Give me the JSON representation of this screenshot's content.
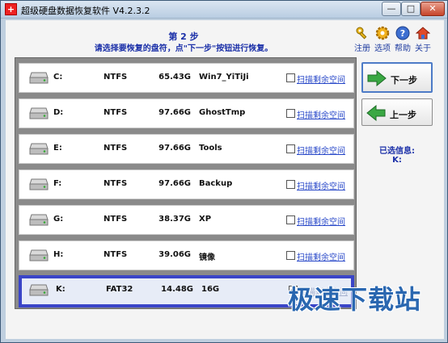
{
  "window": {
    "title": "超级硬盘数据恢复软件 V4.2.3.2",
    "min_label": "—",
    "max_label": "□",
    "close_label": "✕"
  },
  "header": {
    "step_title": "第 2 步",
    "step_desc": "请选择要恢复的盘符，点\"下一步\"按钮进行恢复。"
  },
  "toolbar": {
    "items": [
      {
        "label": "注册",
        "icon": "key-icon"
      },
      {
        "label": "选项",
        "icon": "gear-icon"
      },
      {
        "label": "帮助",
        "icon": "help-icon"
      },
      {
        "label": "关于",
        "icon": "house-icon"
      }
    ]
  },
  "disks": [
    {
      "letter": "C:",
      "fs": "NTFS",
      "size": "65.43G",
      "label": "Win7_YiTiJi",
      "checked": false,
      "scan": "扫描剩余空间"
    },
    {
      "letter": "D:",
      "fs": "NTFS",
      "size": "97.66G",
      "label": "GhostTmp",
      "checked": false,
      "scan": "扫描剩余空间"
    },
    {
      "letter": "E:",
      "fs": "NTFS",
      "size": "97.66G",
      "label": "Tools",
      "checked": false,
      "scan": "扫描剩余空间"
    },
    {
      "letter": "F:",
      "fs": "NTFS",
      "size": "97.66G",
      "label": "Backup",
      "checked": false,
      "scan": "扫描剩余空间"
    },
    {
      "letter": "G:",
      "fs": "NTFS",
      "size": "38.37G",
      "label": "XP",
      "checked": false,
      "scan": "扫描剩余空间"
    },
    {
      "letter": "H:",
      "fs": "NTFS",
      "size": "39.06G",
      "label": "镜像",
      "checked": false,
      "scan": "扫描剩余空间"
    },
    {
      "letter": "K:",
      "fs": "FAT32",
      "size": "14.48G",
      "label": "16G",
      "checked": true,
      "selected": true,
      "scan": "扫描剩余空间"
    }
  ],
  "buttons": {
    "next_label": "下一步",
    "prev_label": "上一步"
  },
  "selection": {
    "title": "已选信息:",
    "value": "K:"
  },
  "watermark": "极速下载站",
  "colors": {
    "accent_blue": "#1a2fa8",
    "selection_border": "#3a45c8",
    "link_blue": "#2747c8",
    "arrow_green": "#3aa843"
  }
}
